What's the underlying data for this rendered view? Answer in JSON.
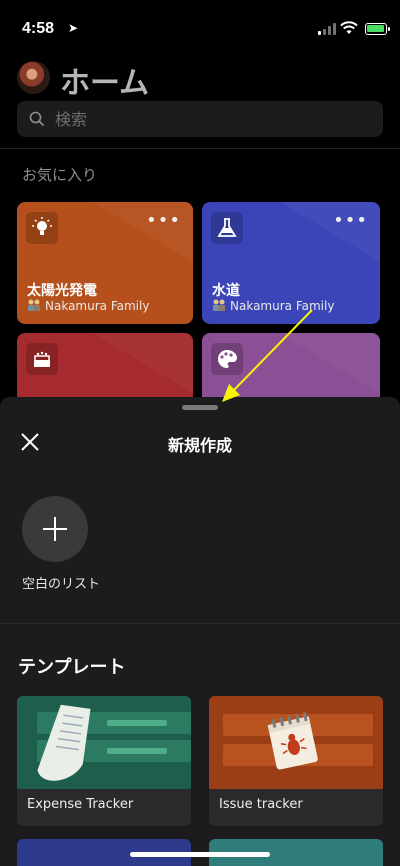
{
  "status_bar": {
    "time": "4:58",
    "location_glyph": "➤"
  },
  "header": {
    "title": "ホーム",
    "search_placeholder": "検索"
  },
  "favorites": {
    "label": "お気に入り",
    "cards": [
      {
        "name": "太陽光発電",
        "owner": "Nakamura Family",
        "icon": "lightbulb-icon",
        "color": "#b5501c"
      },
      {
        "name": "水道",
        "owner": "Nakamura Family",
        "icon": "flask-icon",
        "color": "#3b45b8"
      },
      {
        "name": "",
        "owner": "",
        "icon": "cake-icon",
        "color": "#a52b2e"
      },
      {
        "name": "",
        "owner": "",
        "icon": "palette-icon",
        "color": "#8a4f94"
      }
    ]
  },
  "sheet": {
    "title": "新規作成",
    "blank_list_label": "空白のリスト",
    "templates_heading": "テンプレート",
    "templates": [
      {
        "name": "Expense Tracker",
        "color": "#1e5e4c"
      },
      {
        "name": "Issue tracker",
        "color": "#9c3e15"
      }
    ],
    "more_template_colors": [
      "#2e3a8c",
      "#2f7d7a"
    ]
  },
  "colors": {
    "background": "#000000",
    "sheet": "#1c1c1e",
    "annotation_arrow": "#f5f500"
  }
}
